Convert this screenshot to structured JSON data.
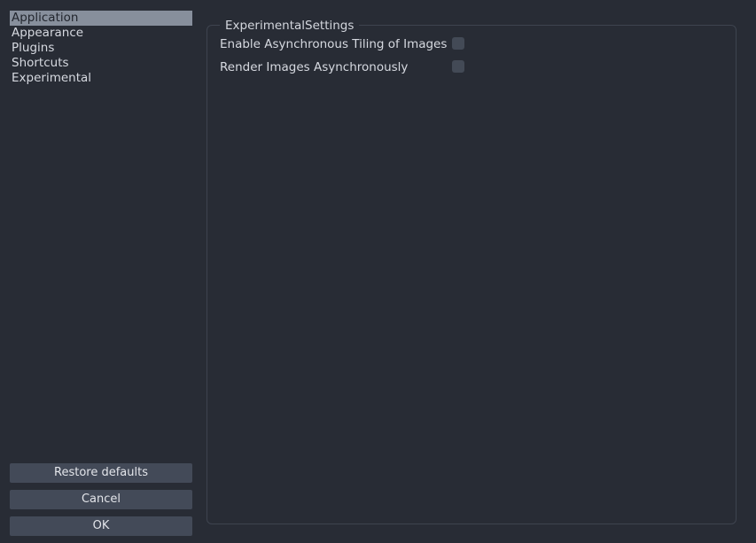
{
  "sidebar": {
    "items": [
      {
        "label": "Application",
        "selected": true
      },
      {
        "label": "Appearance",
        "selected": false
      },
      {
        "label": "Plugins",
        "selected": false
      },
      {
        "label": "Shortcuts",
        "selected": false
      },
      {
        "label": "Experimental",
        "selected": false
      }
    ],
    "selected_index": 0
  },
  "buttons": {
    "restore_defaults_label": "Restore defaults",
    "cancel_label": "Cancel",
    "ok_label": "OK"
  },
  "panel": {
    "group_title": "ExperimentalSettings",
    "settings": [
      {
        "label": "Enable Asynchronous Tiling of Images",
        "checked": false
      },
      {
        "label": "Render Images Asynchronously",
        "checked": false
      }
    ]
  },
  "colors": {
    "background": "#282c35",
    "selection": "#878f9c",
    "button": "#434a58",
    "border": "#3e444f",
    "checkbox": "#434a56",
    "text": "#d6d9e0"
  }
}
